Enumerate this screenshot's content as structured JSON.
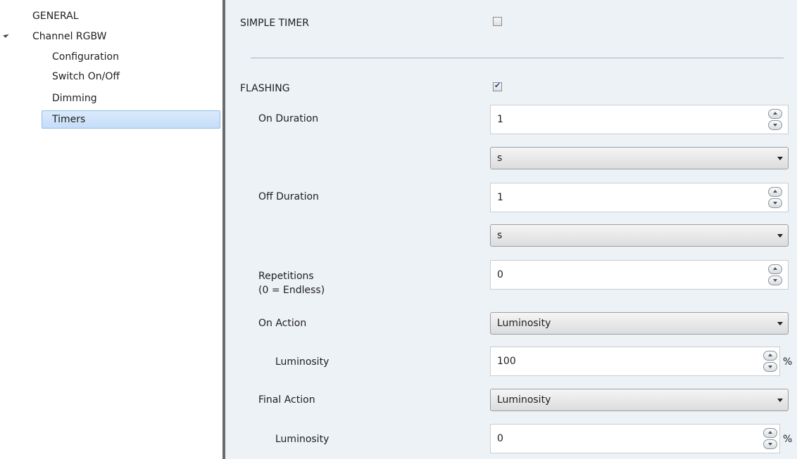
{
  "sidebar": {
    "items": [
      {
        "label": "GENERAL"
      },
      {
        "label": "Channel RGBW"
      },
      {
        "label": "Configuration"
      },
      {
        "label": "Switch On/Off"
      },
      {
        "label": "Dimming"
      },
      {
        "label": "Timers",
        "selected": true
      }
    ]
  },
  "main": {
    "simple_timer": {
      "label": "SIMPLE TIMER",
      "checked": false
    },
    "flashing": {
      "label": "FLASHING",
      "checked": true
    },
    "on_duration": {
      "label": "On Duration",
      "value": "1",
      "unit": "s"
    },
    "off_duration": {
      "label": "Off Duration",
      "value": "1",
      "unit": "s"
    },
    "repetitions": {
      "label_line1": "Repetitions",
      "label_line2": "(0 = Endless)",
      "value": "0"
    },
    "on_action": {
      "label": "On Action",
      "value": "Luminosity"
    },
    "on_luminosity": {
      "label": "Luminosity",
      "value": "100",
      "unit": "%"
    },
    "final_action": {
      "label": "Final Action",
      "value": "Luminosity"
    },
    "final_luminosity": {
      "label": "Luminosity",
      "value": "0",
      "unit": "%"
    }
  },
  "colors": {
    "panel_bg": "#edf2f7",
    "selection": "#c4ddf8",
    "divider": "#6b6b6b"
  }
}
